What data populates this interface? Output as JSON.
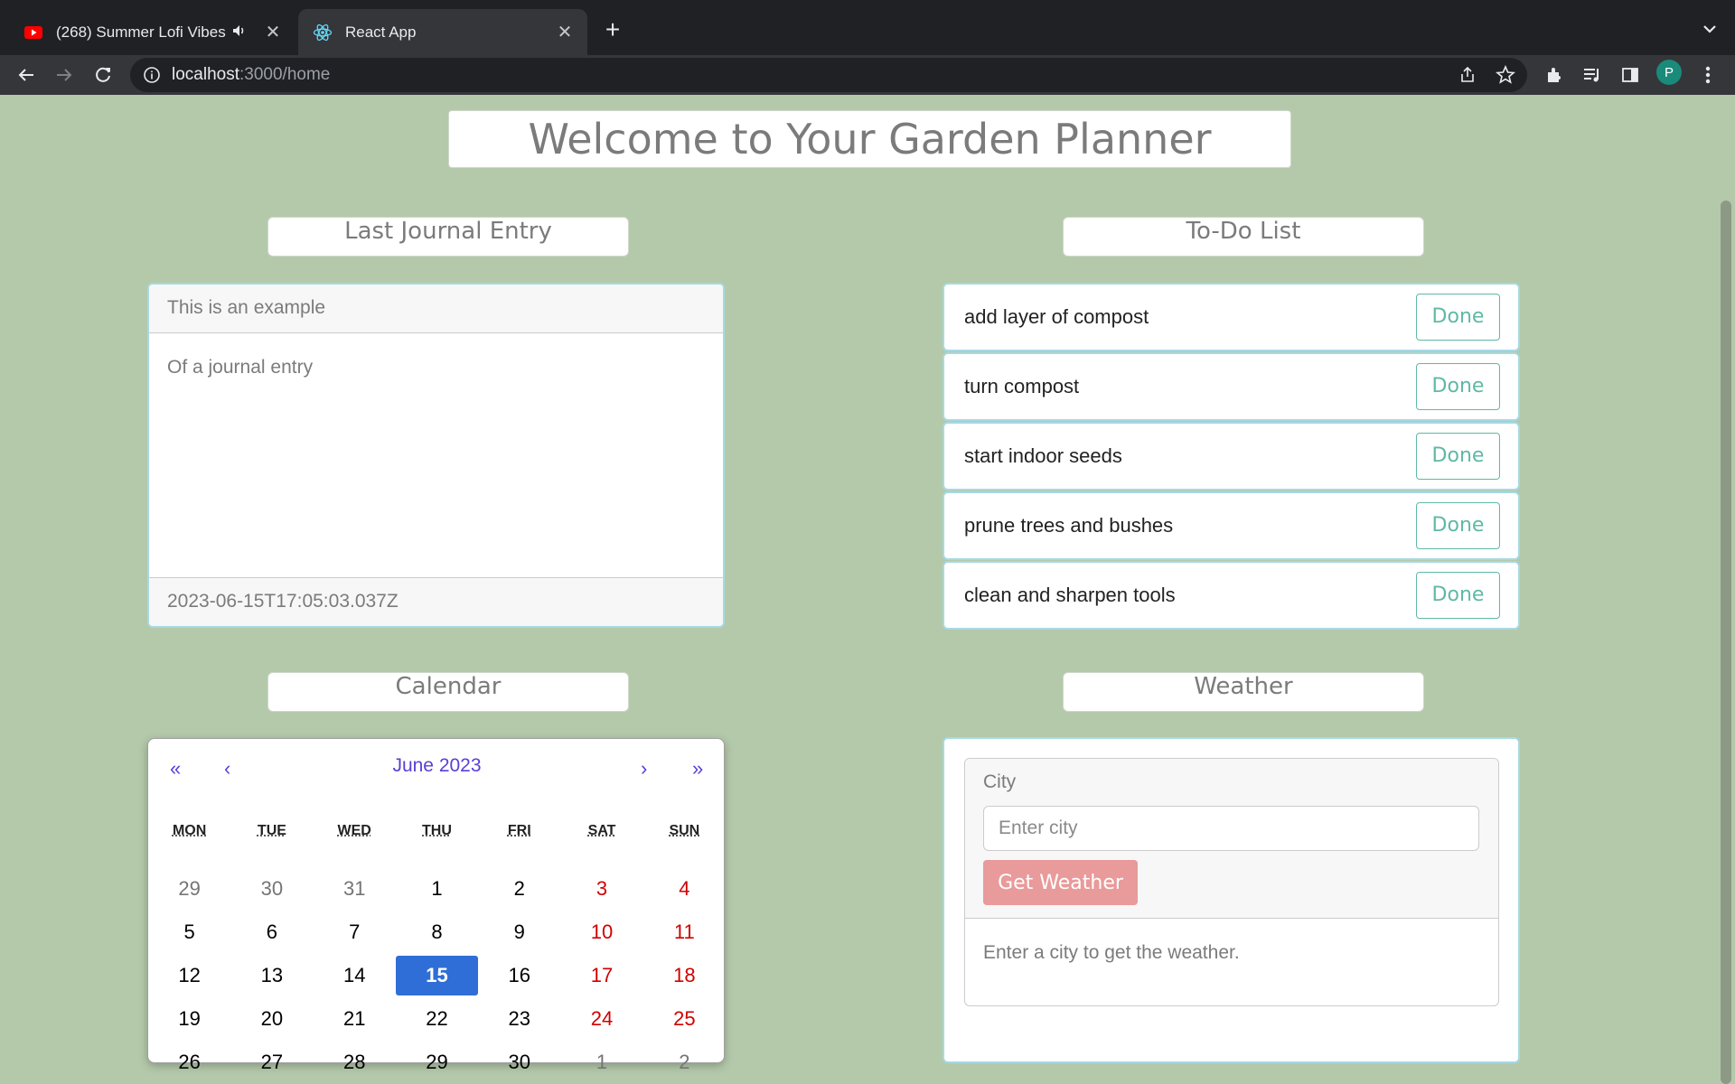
{
  "browser": {
    "tabs": [
      {
        "title": "(268) Summer Lofi Vibes ⚡",
        "icon": "youtube-icon",
        "active": false
      },
      {
        "title": "React App",
        "icon": "react-icon",
        "active": true
      }
    ],
    "url_host": "localhost",
    "url_path": ":3000/home",
    "profile_initial": "P"
  },
  "page": {
    "title": "Welcome to Your Garden Planner"
  },
  "journal": {
    "heading": "Last Journal Entry",
    "entry_title": "This is an example",
    "entry_body": "Of a journal entry",
    "entry_timestamp": "2023-06-15T17:05:03.037Z"
  },
  "todo": {
    "heading": "To-Do List",
    "done_label": "Done",
    "items": [
      {
        "text": "add layer of compost"
      },
      {
        "text": "turn compost"
      },
      {
        "text": "start indoor seeds"
      },
      {
        "text": "prune trees and bushes"
      },
      {
        "text": "clean and sharpen tools"
      }
    ]
  },
  "calendar": {
    "heading": "Calendar",
    "month_label": "June 2023",
    "nav": {
      "prev_year": "«",
      "prev_month": "‹",
      "next_month": "›",
      "next_year": "»"
    },
    "weekdays": [
      "MON",
      "TUE",
      "WED",
      "THU",
      "FRI",
      "SAT",
      "SUN"
    ],
    "weeks": [
      [
        "29",
        "30",
        "31",
        "1",
        "2",
        "3",
        "4"
      ],
      [
        "5",
        "6",
        "7",
        "8",
        "9",
        "10",
        "11"
      ],
      [
        "12",
        "13",
        "14",
        "15",
        "16",
        "17",
        "18"
      ],
      [
        "19",
        "20",
        "21",
        "22",
        "23",
        "24",
        "25"
      ],
      [
        "26",
        "27",
        "28",
        "29",
        "30",
        "1",
        "2"
      ]
    ],
    "selected_day": "15",
    "colors": {
      "weekend": "#d10000",
      "selected": "#2f6ed6",
      "nav": "#5a3fd4"
    }
  },
  "weather": {
    "heading": "Weather",
    "city_label": "City",
    "city_placeholder": "Enter city",
    "button_label": "Get Weather",
    "message": "Enter a city to get the weather."
  }
}
